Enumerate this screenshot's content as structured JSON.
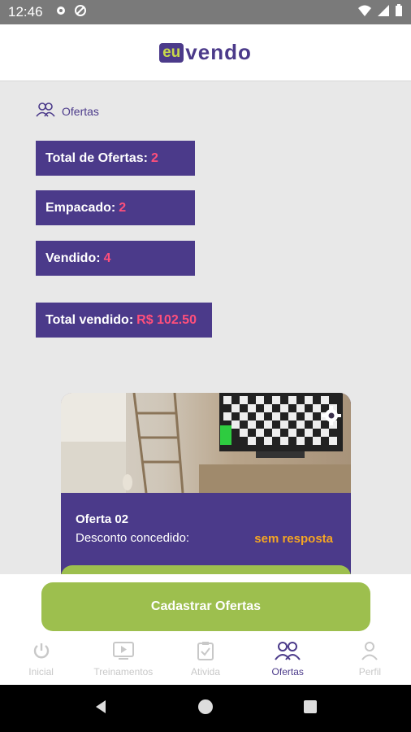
{
  "status_bar": {
    "time": "12:46"
  },
  "header": {
    "logo_badge": "eu",
    "logo_text": "vendo"
  },
  "section": {
    "title": "Ofertas"
  },
  "stats": [
    {
      "label": "Total de Ofertas:",
      "value": "2"
    },
    {
      "label": "Empacado:",
      "value": "2"
    },
    {
      "label": "Vendido:",
      "value": "4"
    },
    {
      "label": "Total vendido:",
      "value": "R$ 102.50"
    }
  ],
  "offer_card": {
    "title": "Oferta 02",
    "discount_label": "Desconto concedido:",
    "discount_status": "sem resposta"
  },
  "cta": {
    "label": "Cadastrar Ofertas"
  },
  "bottom_nav": [
    {
      "label": "Inicial",
      "icon": "power-icon"
    },
    {
      "label": "Treinamentos",
      "icon": "play-icon"
    },
    {
      "label": "Ativida",
      "icon": "clipboard-icon"
    },
    {
      "label": "Ofertas",
      "icon": "users-icon",
      "active": true
    },
    {
      "label": "Perfil",
      "icon": "user-icon"
    }
  ],
  "colors": {
    "brand": "#4b3a8a",
    "accent_green": "#9dbf4e",
    "value_pink": "#ff4f7b",
    "status_orange": "#f5a623"
  }
}
